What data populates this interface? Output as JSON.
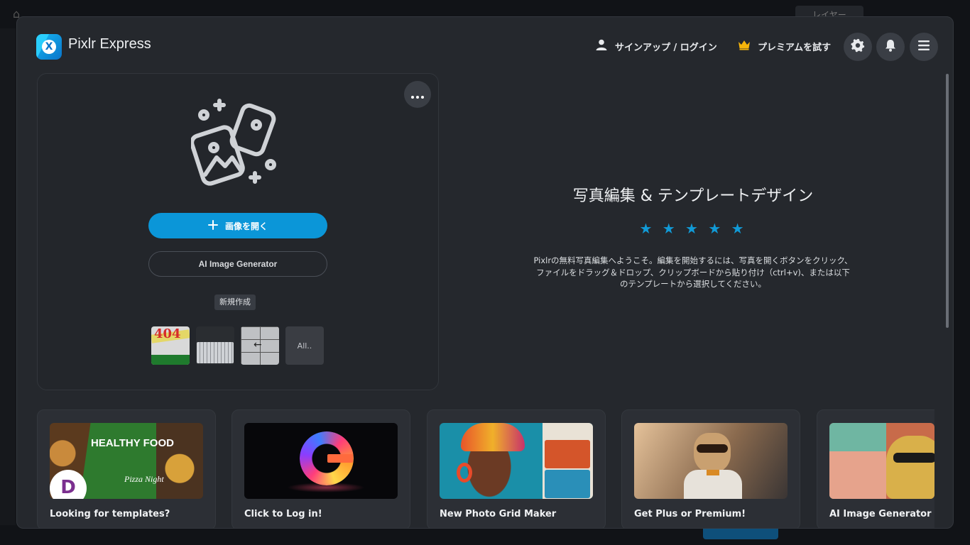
{
  "background_app": {
    "layer_label": "レイヤー"
  },
  "header": {
    "app_title": "Pixlr Express",
    "logo_letter": "X",
    "signin_label": "サインアップ / ログイン",
    "premium_label": "プレミアムを試す"
  },
  "open_card": {
    "open_button_label": "画像を開く",
    "ai_button_label": "AI Image Generator",
    "new_tag": "新規作成",
    "thumbnails": [
      {
        "name": "404-template"
      },
      {
        "name": "keyboard-template"
      },
      {
        "name": "keypad-template"
      },
      {
        "name": "all",
        "label": "All.."
      }
    ],
    "thumb_404_text": "404"
  },
  "info": {
    "title": "写真編集 & テンプレートデザイン",
    "stars": "★ ★ ★ ★ ★",
    "description": "Pixlrの無料写真編集へようこそ。編集を開始するには、写真を開くボタンをクリック、ファイルをドラッグ＆ドロップ、クリップボードから貼り付け（ctrl+v)、または以下のテンプレートから選択してください。"
  },
  "bottom_cards": [
    {
      "label": "Looking for templates?",
      "image": "food-templates",
      "food_text": "HEALTHY FOOD",
      "pizza_text": "Pizza Night",
      "logo_letter": "D"
    },
    {
      "label": "Click to Log in!",
      "image": "glowing-g"
    },
    {
      "label": "New Photo Grid Maker",
      "image": "photo-grid"
    },
    {
      "label": "Get Plus or Premium!",
      "image": "dog-in-car"
    },
    {
      "label": "AI Image Generator",
      "image": "ai-art"
    }
  ],
  "colors": {
    "accent": "#0b96d8",
    "modal_bg": "#25282d",
    "star": "#119ad6",
    "crown": "#f5b40a"
  }
}
